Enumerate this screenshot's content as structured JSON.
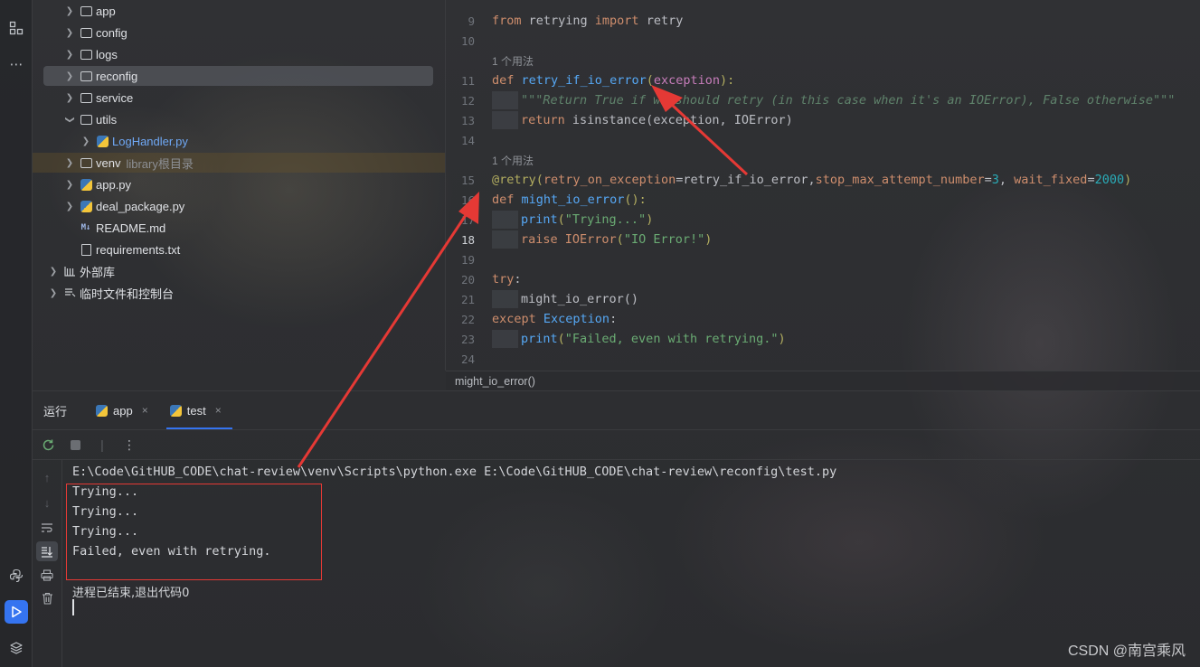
{
  "tree": {
    "items": [
      {
        "label": "app",
        "type": "package",
        "extra": ""
      },
      {
        "label": "config",
        "type": "folder",
        "extra": ""
      },
      {
        "label": "logs",
        "type": "folder",
        "extra": ""
      },
      {
        "label": "reconfig",
        "type": "folder",
        "extra": ""
      },
      {
        "label": "service",
        "type": "package",
        "extra": ""
      },
      {
        "label": "utils",
        "type": "folder",
        "extra": ""
      },
      {
        "label": "LogHandler.py",
        "type": "python",
        "extra": ""
      },
      {
        "label": "venv",
        "type": "folder",
        "extra": "library根目录"
      },
      {
        "label": "app.py",
        "type": "python",
        "extra": ""
      },
      {
        "label": "deal_package.py",
        "type": "python",
        "extra": ""
      },
      {
        "label": "README.md",
        "type": "markdown",
        "extra": ""
      },
      {
        "label": "requirements.txt",
        "type": "text",
        "extra": ""
      },
      {
        "label": "外部库",
        "type": "library",
        "extra": ""
      },
      {
        "label": "临时文件和控制台",
        "type": "scratch",
        "extra": ""
      }
    ]
  },
  "editor": {
    "usage_hint": "1 个用法",
    "lines": {
      "n9": "9",
      "n10": "10",
      "n11": "11",
      "n12": "12",
      "n13": "13",
      "n14": "14",
      "n15": "15",
      "n16": "16",
      "n17": "17",
      "n18": "18",
      "n19": "19",
      "n20": "20",
      "n21": "21",
      "n22": "22",
      "n23": "23",
      "n24": "24"
    },
    "code": {
      "l9_from": "from",
      "l9_mod": " retrying ",
      "l9_import": "import",
      "l9_name": " retry",
      "l11_def": "def",
      "l11_fn": "retry_if_io_error",
      "l11_open": "(",
      "l11_param": "exception",
      "l11_close": "):",
      "l12_doc": "\"\"\"Return True if we should retry (in this case when it's an IOError), False otherwise\"\"\"",
      "l13_return": "return",
      "l13_call": " isinstance(exception, IOError)",
      "l15_dec": "@retry",
      "l15_open": "(",
      "l15_p1": "retry_on_exception",
      "l15_eq1": "=retry_if_io_error,",
      "l15_p2": "stop_max_attempt_number",
      "l15_eq2": "=",
      "l15_v2": "3",
      "l15_sep": ", ",
      "l15_p3": "wait_fixed",
      "l15_eq3": "=",
      "l15_v3": "2000",
      "l15_close": ")",
      "l16_def": "def",
      "l16_fn": "might_io_error",
      "l16_rest": "():",
      "l17_fn": "print",
      "l17_open": "(",
      "l17_str": "\"Trying...\"",
      "l17_close": ")",
      "l18_raise": "raise",
      "l18_cls": " IOError",
      "l18_open": "(",
      "l18_str": "\"IO Error!\"",
      "l18_close": ")",
      "l20_try": "try",
      "l20_colon": ":",
      "l21_call": "might_io_error()",
      "l22_except": "except",
      "l22_cls": " Exception",
      "l22_colon": ":",
      "l23_fn": "print",
      "l23_open": "(",
      "l23_str": "\"Failed, even with retrying.\"",
      "l23_close": ")"
    },
    "breadcrumb": "might_io_error()"
  },
  "run": {
    "title": "运行",
    "tabs": [
      {
        "label": "app",
        "close": "×"
      },
      {
        "label": "test",
        "close": "×"
      }
    ],
    "console_lines": [
      "E:\\Code\\GitHUB_CODE\\chat-review\\venv\\Scripts\\python.exe E:\\Code\\GitHUB_CODE\\chat-review\\reconfig\\test.py",
      "Trying...",
      "Trying...",
      "Trying...",
      "Failed, even with retrying.",
      "",
      "进程已结束,退出代码0"
    ]
  },
  "watermark": "CSDN @南宫乘风",
  "colors": {
    "accent": "#3574f0",
    "annotation_red": "#e53935"
  }
}
